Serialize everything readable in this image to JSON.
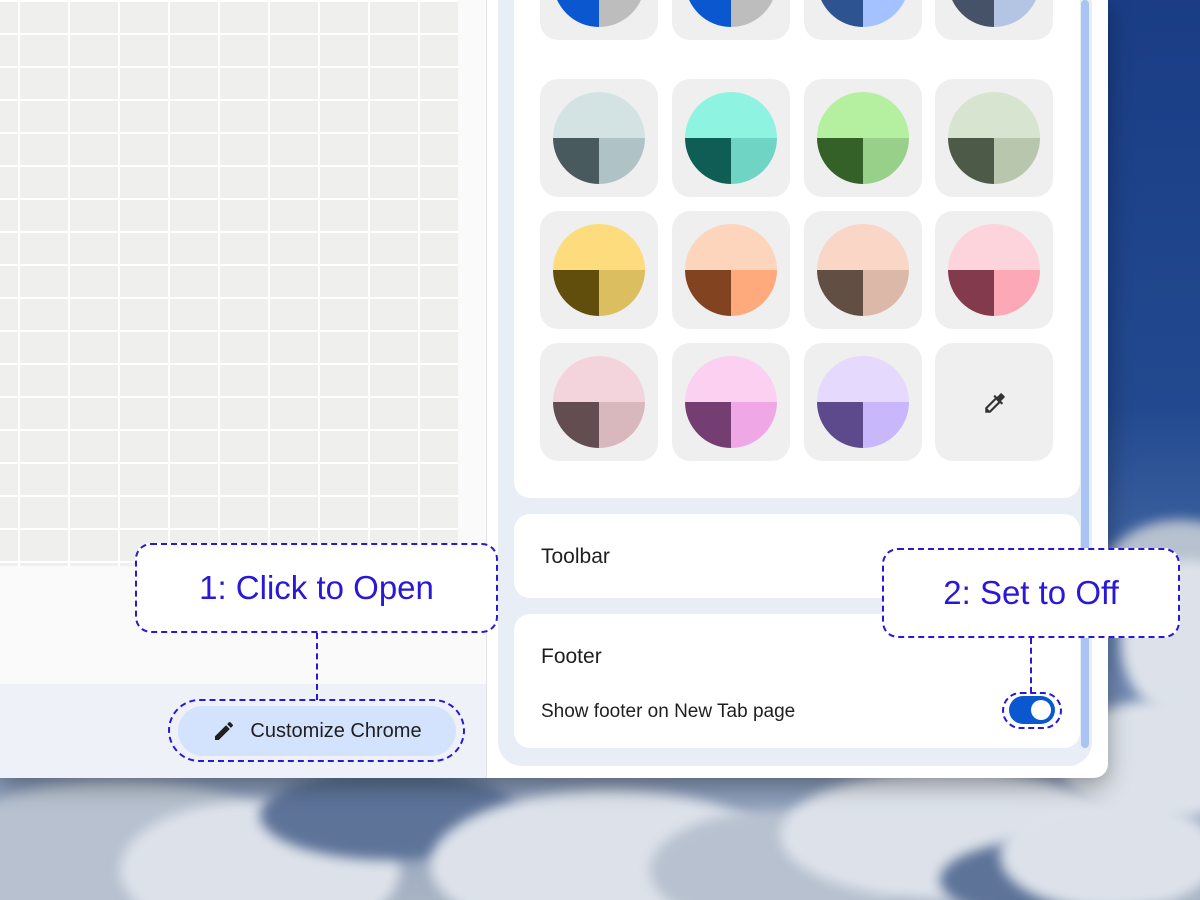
{
  "side_panel": {
    "color_swatches": [
      {
        "top": "#c7d3e8",
        "left": "#0b57d0",
        "right": "#bdbdbd"
      },
      {
        "top": "#c7d3e8",
        "left": "#0b57d0",
        "right": "#bdbdbd"
      },
      {
        "top": "#c6d6f5",
        "left": "#2d5490",
        "right": "#a4c2ff"
      },
      {
        "top": "#d4dbe9",
        "left": "#465268",
        "right": "#b4c5e4"
      },
      {
        "top": "#d3e3e4",
        "left": "#495a5e",
        "right": "#afc3c6"
      },
      {
        "top": "#8ff3e2",
        "left": "#0f5e55",
        "right": "#6fd4c3"
      },
      {
        "top": "#b5f0a0",
        "left": "#336127",
        "right": "#98d08a"
      },
      {
        "top": "#d7e4cf",
        "left": "#4e5a48",
        "right": "#b7c6ad"
      },
      {
        "top": "#fcdc7c",
        "left": "#614d0c",
        "right": "#dbbe5f"
      },
      {
        "top": "#fdd5bc",
        "left": "#824321",
        "right": "#feaa7c"
      },
      {
        "top": "#f9d6c5",
        "left": "#624f43",
        "right": "#dcb8a9"
      },
      {
        "top": "#fdd4dc",
        "left": "#843a4d",
        "right": "#fca8b6"
      },
      {
        "top": "#f4d4dc",
        "left": "#634d50",
        "right": "#d9b8bd"
      },
      {
        "top": "#fbd0f1",
        "left": "#743e72",
        "right": "#efa8e5"
      },
      {
        "top": "#e5d9fd",
        "left": "#5c4a8d",
        "right": "#c9b7fb"
      }
    ],
    "custom_color_icon": "eyedropper-icon",
    "toolbar_title": "Toolbar",
    "footer_title": "Footer",
    "footer_toggle_label": "Show footer on New Tab page",
    "footer_toggle_on": true
  },
  "new_tab_page": {
    "customize_button_label": "Customize Chrome",
    "customize_button_icon": "pencil-icon"
  },
  "annotations": {
    "step1": "1: Click to Open",
    "step2": "2: Set to Off"
  }
}
